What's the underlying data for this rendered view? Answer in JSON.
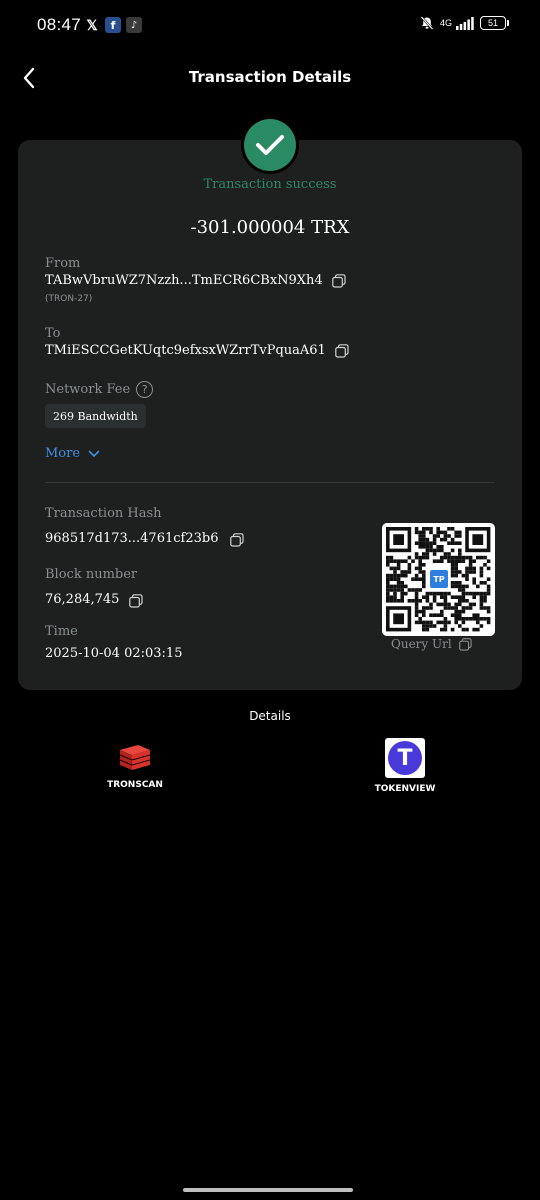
{
  "status_bar": {
    "time": "08:47",
    "notifications": [
      "x-icon",
      "facebook-icon",
      "tiktok-icon"
    ],
    "network": "4G",
    "battery": "51"
  },
  "header": {
    "title": "Transaction Details",
    "back_icon": "chevron-left-icon"
  },
  "transaction": {
    "status": "Transaction success",
    "amount": "-301.000004 TRX",
    "from_label": "From",
    "from_value": "TABwVbruWZ7Nzzh...TmECR6CBxN9Xh4",
    "from_note": "(TRON-27)",
    "to_label": "To",
    "to_value": "TMiESCCGetKUqtc9efxsxWZrrTvPquaA61",
    "fee_label": "Network Fee",
    "fee_value": "269 Bandwidth",
    "more_label": "More",
    "hash_label": "Transaction Hash",
    "hash_value": "968517d173...4761cf23b6",
    "block_label": "Block number",
    "block_value": "76,284,745",
    "time_label": "Time",
    "time_value": "2025-10-04 02:03:15",
    "query_url_label": "Query Url",
    "qr_logo": "TP"
  },
  "details": {
    "title": "Details",
    "explorers": [
      {
        "label": "TRONSCAN",
        "icon": "tronscan-icon"
      },
      {
        "label": "TOKENVIEW",
        "icon": "tokenview-icon",
        "glyph": "T"
      }
    ]
  },
  "colors": {
    "success": "#2a8a63",
    "link": "#3d8de0",
    "card": "#1e2020",
    "tronscan_red": "#d8322c",
    "tokenview_purple": "#4a39d9"
  }
}
